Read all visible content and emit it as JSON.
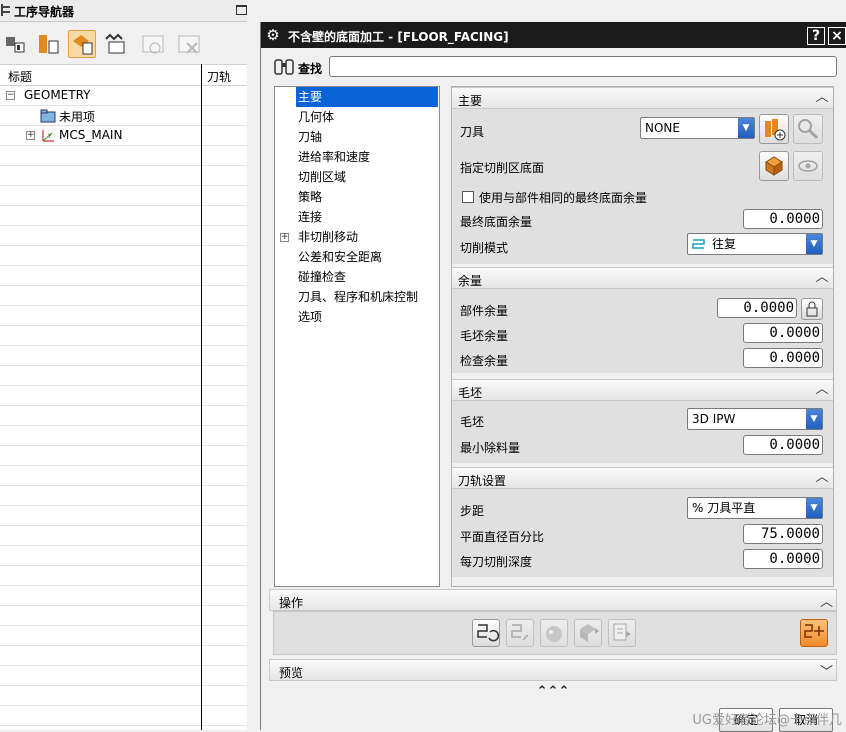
{
  "navigator": {
    "title": "工序导航器",
    "columns": {
      "name": "标题",
      "toolpath": "刀轨"
    },
    "tree": [
      {
        "label": "GEOMETRY",
        "expander": "⊟"
      },
      {
        "label": "未用项"
      },
      {
        "label": "MCS_MAIN",
        "expander": "+"
      }
    ]
  },
  "dialog": {
    "title": "不含壁的底面加工 - [FLOOR_FACING]",
    "help": "?",
    "close": "×",
    "find_label": "查找",
    "find_value": "",
    "pages": [
      "主要",
      "几何体",
      "刀轴",
      "进给率和速度",
      "切削区域",
      "策略",
      "连接",
      "非切削移动",
      "公差和安全距离",
      "碰撞检查",
      "刀具、程序和机床控制",
      "选项"
    ],
    "selected_page": "主要",
    "groups": {
      "main": {
        "title": "主要",
        "tool_label": "刀具",
        "tool_value": "NONE",
        "cut_floor_label": "指定切削区底面",
        "same_floor_stock_label": "使用与部件相同的最终底面余量",
        "final_floor_stock_label": "最终底面余量",
        "final_floor_stock_value": "0.0000",
        "cut_pattern_label": "切削模式",
        "cut_pattern_value": "往复"
      },
      "stock": {
        "title": "余量",
        "part_stock_label": "部件余量",
        "part_stock_value": "0.0000",
        "blank_stock_label": "毛坯余量",
        "blank_stock_value": "0.0000",
        "check_stock_label": "检查余量",
        "check_stock_value": "0.0000"
      },
      "blank": {
        "title": "毛坯",
        "blank_label": "毛坯",
        "blank_value": "3D IPW",
        "min_removal_label": "最小除料量",
        "min_removal_value": "0.0000"
      },
      "path": {
        "title": "刀轨设置",
        "stepover_label": "步距",
        "stepover_value": "% 刀具平直",
        "flat_diam_label": "平面直径百分比",
        "flat_diam_value": "75.0000",
        "depth_label": "每刀切削深度",
        "depth_value": "0.0000"
      }
    },
    "operations_label": "操作",
    "preview_label": "预览",
    "more": "⌃⌃⌃",
    "ok": "确定",
    "cancel": "取消"
  },
  "watermark": "UG爱好者论坛@十点伴几"
}
